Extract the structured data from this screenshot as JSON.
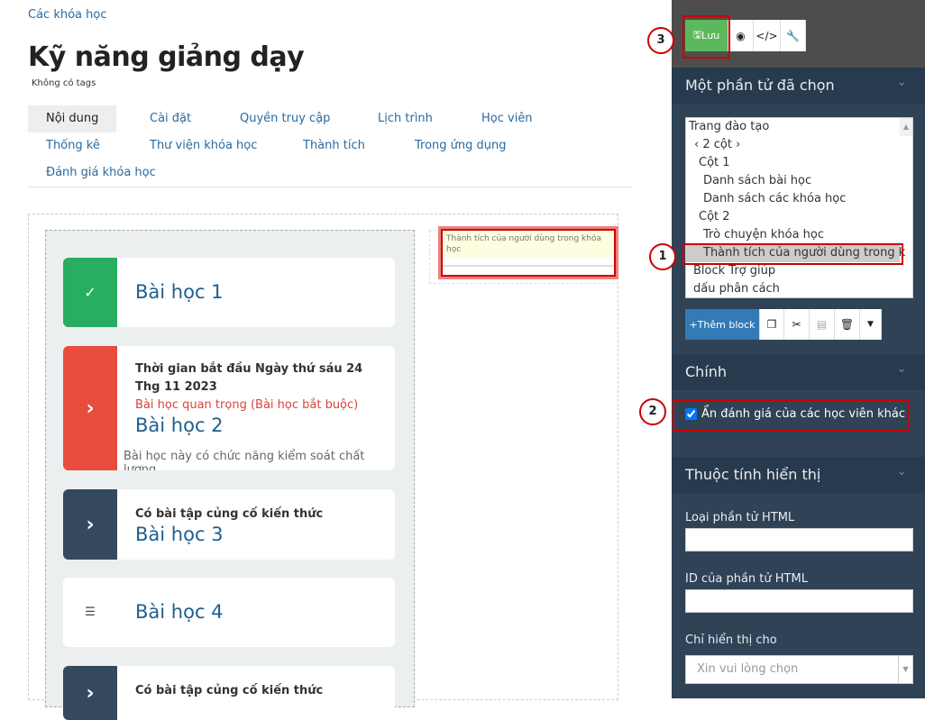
{
  "breadcrumb": "Các khóa học",
  "page_title": "Kỹ năng giảng dạy",
  "tags": "Không có tags",
  "tabs": [
    "Nội dung",
    "Cài đặt",
    "Quyền truy cập",
    "Lịch trình",
    "Học viên",
    "Thống kê",
    "Thư viện khóa học",
    "Thành tích",
    "Trong ứng dụng",
    "Đánh giá khóa học"
  ],
  "lessons": [
    {
      "title": "Bài học 1",
      "icon": "check-icon",
      "color": "#27ae60"
    },
    {
      "start": "Thời gian bắt đầu Ngày thứ sáu 24 Thg 11 2023",
      "required": "Bài học quan trọng (Bài học bắt buộc)",
      "title": "Bài học 2",
      "note": "Bài học này có chức năng kiểm soát chất lượng",
      "icon": "chevron-right-icon",
      "color": "#e74c3c"
    },
    {
      "sub": "Có bài tập củng cố kiến thức",
      "title": "Bài học 3",
      "icon": "chevron-right-icon",
      "color": "#34495e"
    },
    {
      "title": "Bài học 4",
      "icon": "list-icon",
      "color": "#ffffff"
    },
    {
      "sub": "Có bài tập củng cố kiến thức",
      "icon": "chevron-right-icon",
      "color": "#34495e"
    }
  ],
  "selected_block": "Thành tích của người dùng trong khóa học",
  "toolbar": {
    "save": "Lưu"
  },
  "sections": {
    "selected": "Một phần tử đã chọn",
    "main": "Chính",
    "display": "Thuộc tính hiển thị"
  },
  "tree": [
    "Trang đào tạo",
    "‹ 2 cột ›",
    "Cột 1",
    "Danh sách bài học",
    "Danh sách các khóa học",
    "Cột 2",
    "Trò chuyện khóa học",
    "Thành tích của người dùng trong k",
    "Block Trợ giúp",
    "dấu phân cách"
  ],
  "add_block": "+Thêm block",
  "hide_reviews": {
    "label": "Ẩn đánh giá của các học viên khác",
    "checked": true
  },
  "fields": {
    "html_type": "Loại phần tử HTML",
    "html_id": "ID của phần tử HTML",
    "show_for": "Chỉ hiển thị cho",
    "show_for_placeholder": "Xin vui lòng chọn"
  },
  "markers": [
    "1",
    "2",
    "3"
  ],
  "colors": {
    "save": "#5cb85c",
    "add_block": "#337ab7",
    "panel": "#2f4256"
  }
}
